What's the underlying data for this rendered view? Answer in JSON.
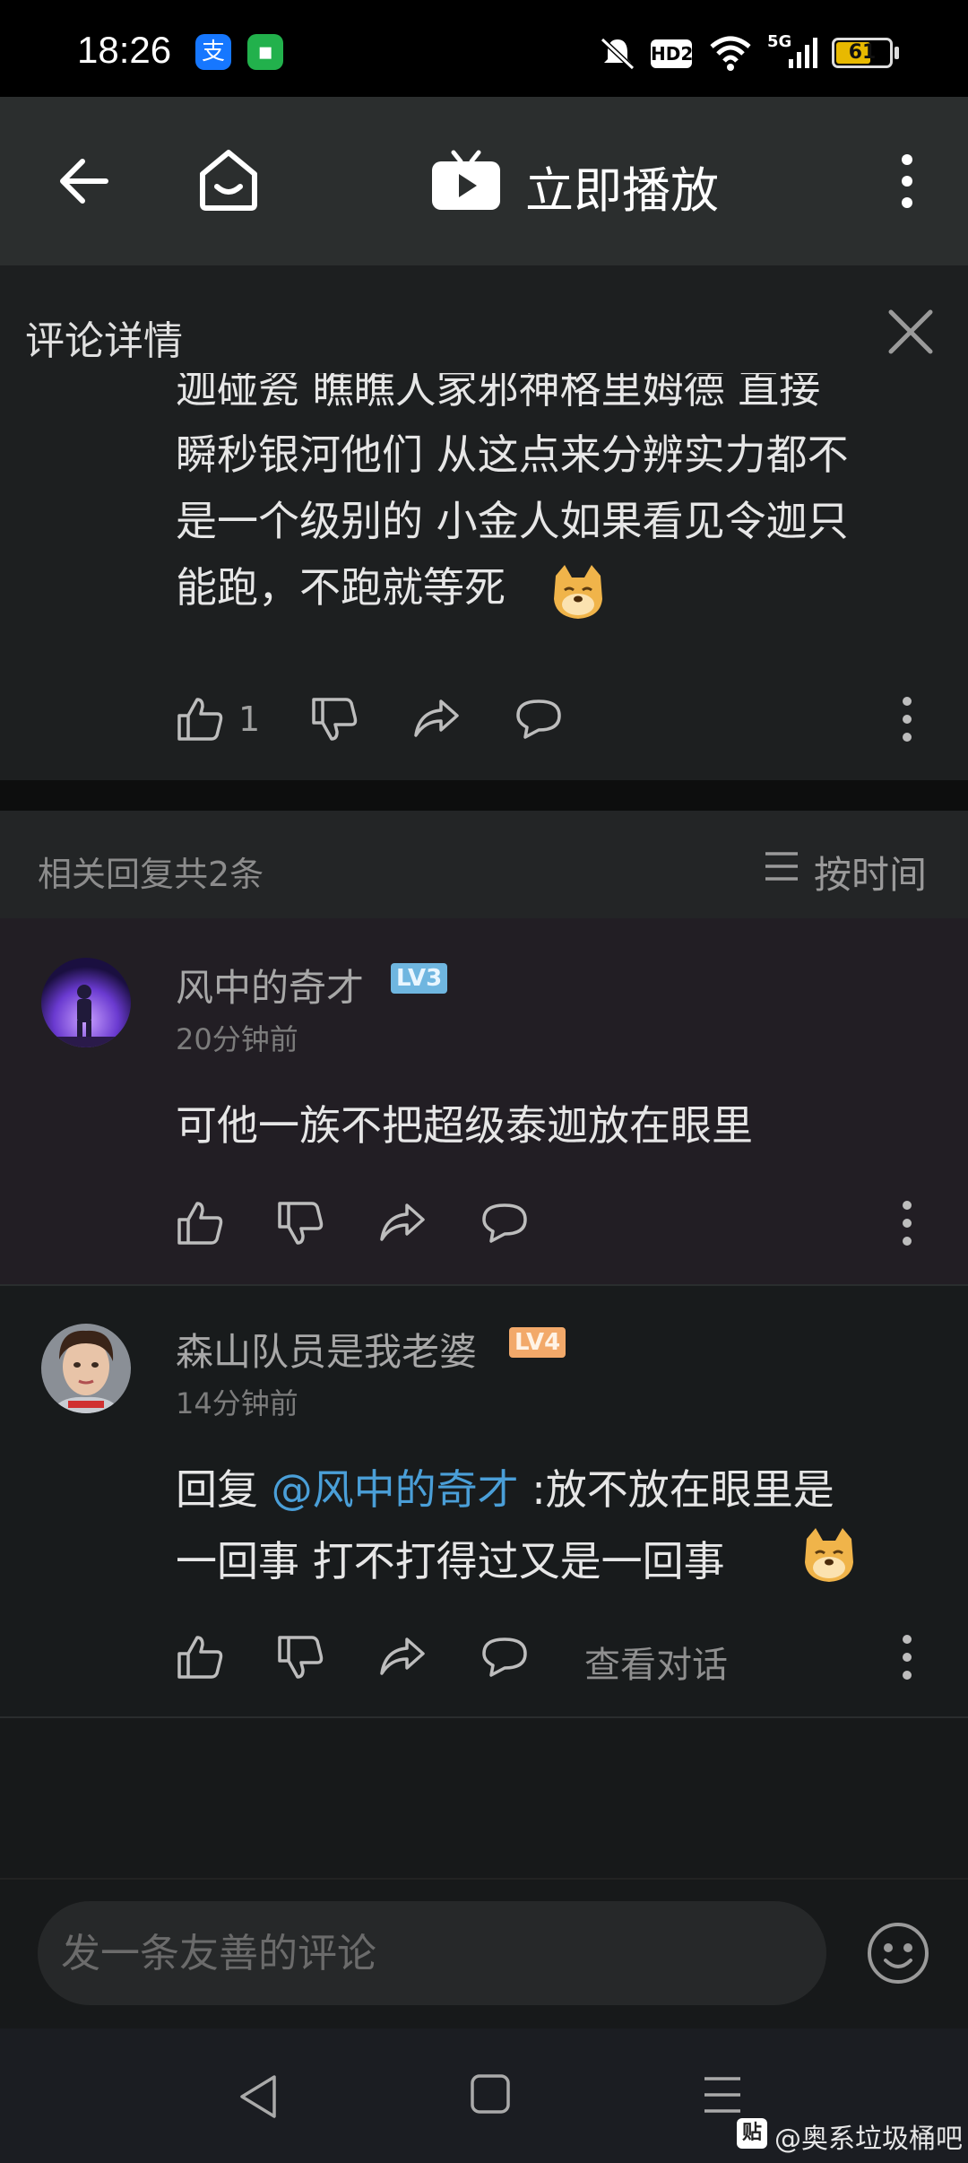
{
  "status_bar": {
    "time": "18:26",
    "battery": "61",
    "network": "5G",
    "hd_badge": "HD2",
    "icons": [
      "alipay-icon",
      "message-icon",
      "mute-icon",
      "hd-icon",
      "wifi-icon",
      "signal-icon",
      "battery-icon"
    ]
  },
  "title_bar": {
    "title": "立即播放"
  },
  "details": {
    "header": "评论详情"
  },
  "parent_comment": {
    "lines": [
      "迦碰瓷 瞧瞧人家邪神格里姆德 直接",
      "瞬秒银河他们 从这点来分辨实力都不",
      "是一个级别的 小金人如果看见令迦只",
      "能跑，不跑就等死"
    ],
    "like_count": "1"
  },
  "replies_header": {
    "count_label": "相关回复共2条",
    "sort_label": "按时间"
  },
  "replies": [
    {
      "username": "风中的奇才",
      "level": "LV3",
      "level_color": "#6fb6e0",
      "time": "20分钟前",
      "text": "可他一族不把超级泰迦放在眼里"
    },
    {
      "username": "森山队员是我老婆",
      "level": "LV4",
      "level_color": "#f2a96a",
      "time": "14分钟前",
      "reply_prefix": "回复 ",
      "mention": "@风中的奇才",
      "text_line1": " :放不放在眼里是",
      "text_line2": "一回事  打不打得过又是一回事",
      "view_conversation": "查看对话"
    }
  ],
  "input": {
    "placeholder": "发一条友善的评论"
  },
  "watermark": "@奥系垃圾桶吧",
  "colors": {
    "accent_link": "#4a9fd8",
    "background": "#17191a"
  }
}
